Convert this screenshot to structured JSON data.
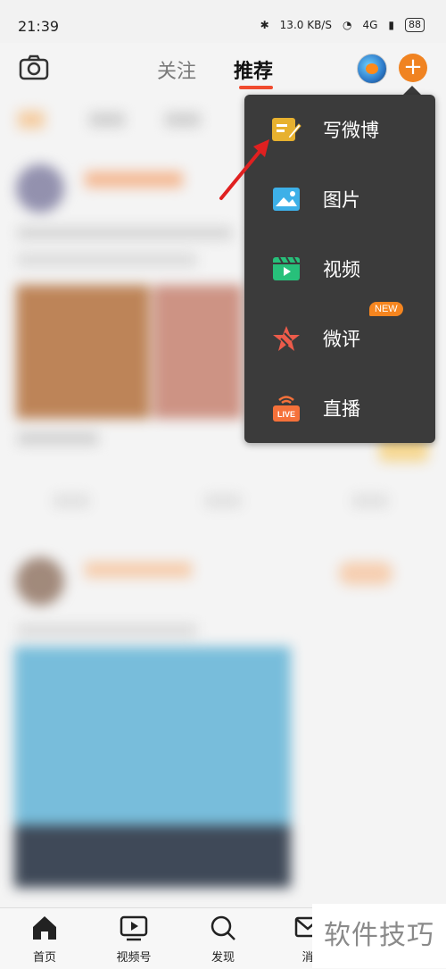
{
  "status_bar": {
    "time": "21:39",
    "speed": "13.0 KB/S",
    "signal": "4G",
    "battery": "88"
  },
  "header": {
    "tabs": [
      {
        "label": "关注"
      },
      {
        "label": "推荐",
        "active": true
      }
    ]
  },
  "menu": {
    "items": [
      {
        "label": "写微博",
        "icon": "compose-icon"
      },
      {
        "label": "图片",
        "icon": "image-icon"
      },
      {
        "label": "视频",
        "icon": "video-icon"
      },
      {
        "label": "微评",
        "icon": "star-review-icon",
        "badge": "NEW"
      },
      {
        "label": "直播",
        "icon": "live-icon"
      }
    ]
  },
  "bottom_nav": [
    {
      "label": "首页",
      "icon": "home-icon"
    },
    {
      "label": "视频号",
      "icon": "video-channel-icon"
    },
    {
      "label": "发现",
      "icon": "search-icon"
    },
    {
      "label": "消",
      "icon": "message-icon"
    }
  ],
  "watermark": "软件技巧",
  "colors": {
    "accent": "#f08321",
    "menu_bg": "#3b3b3b",
    "tab_underline": "#f04b2f",
    "pointer": "#e02020"
  }
}
